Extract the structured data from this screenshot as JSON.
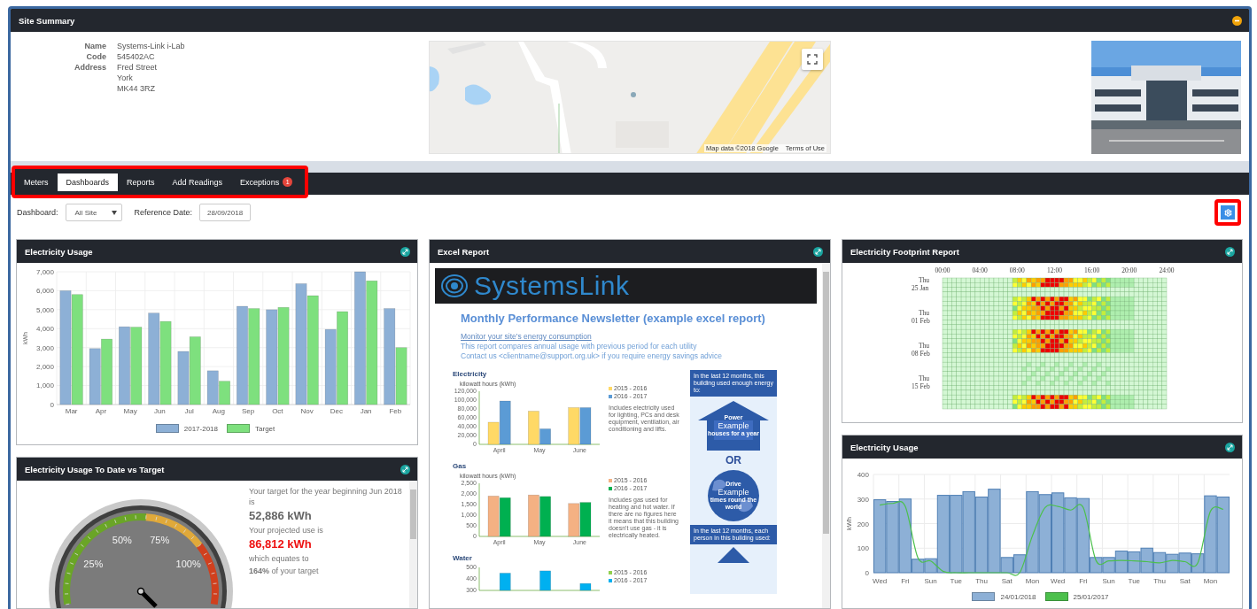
{
  "site_summary": {
    "title": "Site Summary",
    "fields": [
      {
        "label": "Name",
        "lines": [
          "Systems-Link i-Lab"
        ]
      },
      {
        "label": "Code",
        "lines": [
          "545402AC"
        ]
      },
      {
        "label": "Address",
        "lines": [
          "Fred Street",
          "York",
          "MK44 3RZ"
        ]
      }
    ],
    "map": {
      "kind": "picture",
      "attribution": "Map data ©2018 Google",
      "terms": "Terms of Use"
    }
  },
  "tabs": [
    {
      "label": "Meters",
      "selected": false
    },
    {
      "label": "Dashboards",
      "selected": true
    },
    {
      "label": "Reports",
      "selected": false
    },
    {
      "label": "Add Readings",
      "selected": false
    },
    {
      "label": "Exceptions",
      "selected": false,
      "badge": "1"
    }
  ],
  "toolbar": {
    "dashboard_label": "Dashboard:",
    "dashboard_value": "All Site",
    "date_label": "Reference Date:",
    "date_value": "28/09/2018"
  },
  "electricity_usage": {
    "title": "Electricity Usage",
    "chart_data": {
      "type": "bar",
      "grid": true,
      "ylabel": "kWh",
      "categories": [
        "Mar",
        "Apr",
        "May",
        "Jun",
        "Jul",
        "Aug",
        "Sep",
        "Oct",
        "Nov",
        "Dec",
        "Jan",
        "Feb"
      ],
      "ylim": [
        0,
        7000
      ],
      "yticks": [
        0,
        {
          "value": 1000,
          "label": "1,000"
        },
        {
          "value": 2000,
          "label": "2,000"
        },
        {
          "value": 3000,
          "label": "3,000"
        },
        {
          "value": 4000,
          "label": "4,000"
        },
        {
          "value": 5000,
          "label": "5,000"
        },
        {
          "value": 6000,
          "label": "6,000"
        },
        {
          "value": 7000,
          "label": "7,000"
        }
      ],
      "series": [
        {
          "name": "2017-2018",
          "color": "#8db0d6",
          "values": [
            6000,
            2950,
            4100,
            4820,
            2800,
            1780,
            5180,
            5000,
            6370,
            3960,
            7000,
            5060
          ]
        },
        {
          "name": "Target",
          "color": "#7ee07e",
          "values": [
            5800,
            3450,
            4080,
            4380,
            3570,
            1230,
            5060,
            5120,
            5740,
            4900,
            6520,
            3000
          ]
        }
      ]
    }
  },
  "usage_vs_target": {
    "title": "Electricity Usage To Date vs Target",
    "gauge_labels": [
      "25%",
      "50%",
      "75%",
      "100%"
    ],
    "lines": [
      {
        "kind": "text",
        "text": "Your target for the year beginning Jun 2018 is"
      },
      {
        "kind": "figure",
        "text": "52,886 kWh"
      },
      {
        "kind": "text",
        "text": "Your projected use is"
      },
      {
        "kind": "alert_figure",
        "text": "86,812 kWh"
      },
      {
        "kind": "text",
        "text": "which equates to"
      },
      {
        "kind": "rich",
        "text": "**164%** of your target"
      }
    ]
  },
  "excel_report": {
    "title": "Excel Report",
    "brand": "SystemsLink",
    "heading": "Monthly Performance Newsletter (example excel report)",
    "link": "Monitor your site's energy consumption",
    "intro": [
      "This report compares annual usage with previous period for each utility",
      "Contact us <clientname@support.org.uk> if you require energy savings advice"
    ],
    "sections": [
      {
        "title": "Electricity",
        "description": "Includes electricity used for lighting, PCs and desk equipment, ventilation, air conditioning and lifts.",
        "chart_data": {
          "type": "bar",
          "ylabel": "kilowatt hours (kWh)",
          "categories": [
            "April",
            "May",
            "June"
          ],
          "ylim": [
            0,
            120000
          ],
          "yticks": [
            0,
            {
              "value": 20000,
              "label": "20,000"
            },
            {
              "value": 40000,
              "label": "40,000"
            },
            {
              "value": 60000,
              "label": "60,000"
            },
            {
              "value": 80000,
              "label": "80,000"
            },
            {
              "value": 100000,
              "label": "100,000"
            },
            {
              "value": 120000,
              "label": "120,000"
            }
          ],
          "series": [
            {
              "name": "2015 - 2016",
              "color": "#ffd966",
              "values": [
                50000,
                75000,
                83000
              ]
            },
            {
              "name": "2016 - 2017",
              "color": "#5b9bd5",
              "values": [
                98000,
                35000,
                83000
              ]
            }
          ]
        }
      },
      {
        "title": "Gas",
        "description": "Includes gas used for heating and hot water. If there are no figures here it means that this building doesn't use gas - it is electrically heated.",
        "chart_data": {
          "type": "bar",
          "ylabel": "kilowatt hours (kWh)",
          "categories": [
            "April",
            "May",
            "June"
          ],
          "ylim": [
            0,
            2500
          ],
          "yticks": [
            0,
            500,
            {
              "value": 1000,
              "label": "1,000"
            },
            {
              "value": 1500,
              "label": "1,500"
            },
            {
              "value": 2000,
              "label": "2,000"
            },
            {
              "value": 2500,
              "label": "2,500"
            }
          ],
          "series": [
            {
              "name": "2015 - 2016",
              "color": "#f4b183",
              "values": [
                1900,
                1950,
                1550
              ]
            },
            {
              "name": "2016 - 2017",
              "color": "#00b050",
              "values": [
                1820,
                1880,
                1600
              ]
            }
          ]
        }
      },
      {
        "title": "Water",
        "chart_data": {
          "type": "bar",
          "ylim": [
            300,
            500
          ],
          "yticks": [
            300,
            400,
            500
          ],
          "series": [
            {
              "name": "2015 - 2016",
              "color": "#92d050",
              "values": [
                null,
                null,
                null
              ]
            },
            {
              "name": "2016 - 2017",
              "color": "#00b0f0",
              "values": [
                450,
                470,
                360
              ]
            }
          ]
        }
      }
    ],
    "infographic": {
      "energy_note": "In the last 12 months, this building used enough energy to:",
      "house": [
        "Power",
        "Example",
        "houses for a year"
      ],
      "or": "OR",
      "globe": [
        "Drive",
        "Example",
        "times round the world"
      ],
      "person_note": "In the last 12 months, each person in this building used:"
    }
  },
  "footprint": {
    "title": "Electricity Footprint Report",
    "time_labels": [
      "00:00",
      "04:00",
      "08:00",
      "12:00",
      "16:00",
      "20:00",
      "24:00"
    ],
    "date_labels": [
      {
        "day": "Thu",
        "date": "25 Jan"
      },
      {
        "day": "Thu",
        "date": "01 Feb"
      },
      {
        "day": "Thu",
        "date": "08 Feb"
      },
      {
        "day": "Thu",
        "date": "15 Feb"
      }
    ]
  },
  "daily_usage": {
    "title": "Electricity Usage",
    "chart_data": {
      "type": "bar",
      "grid": true,
      "ylabel": "kWh",
      "ylim": [
        0,
        400
      ],
      "yticks": [
        0,
        100,
        200,
        300,
        400
      ],
      "categories": [
        "Wed",
        null,
        "Fri",
        null,
        "Sun",
        null,
        "Tue",
        null,
        "Thu",
        null,
        "Sat",
        null,
        "Mon",
        null,
        "Wed",
        null,
        "Fri",
        null,
        "Sun",
        null,
        "Tue",
        null,
        "Thu",
        null,
        "Sat",
        null,
        "Mon",
        null
      ],
      "series": [
        {
          "name": "24/01/2018",
          "type": "bar",
          "color": "#8db0d6",
          "values": [
            297,
            290,
            300,
            55,
            57,
            315,
            315,
            330,
            308,
            340,
            62,
            73,
            330,
            318,
            325,
            305,
            302,
            62,
            62,
            88,
            85,
            100,
            82,
            75,
            80,
            77,
            313,
            308
          ]
        },
        {
          "name": "25/01/2017",
          "type": "line",
          "color": "#4cc04c",
          "values": [
            275,
            282,
            270,
            60,
            48,
            5,
            0,
            0,
            0,
            0,
            0,
            0,
            150,
            265,
            270,
            255,
            265,
            50,
            48,
            50,
            48,
            45,
            40,
            50,
            45,
            40,
            250,
            258
          ]
        }
      ]
    }
  }
}
